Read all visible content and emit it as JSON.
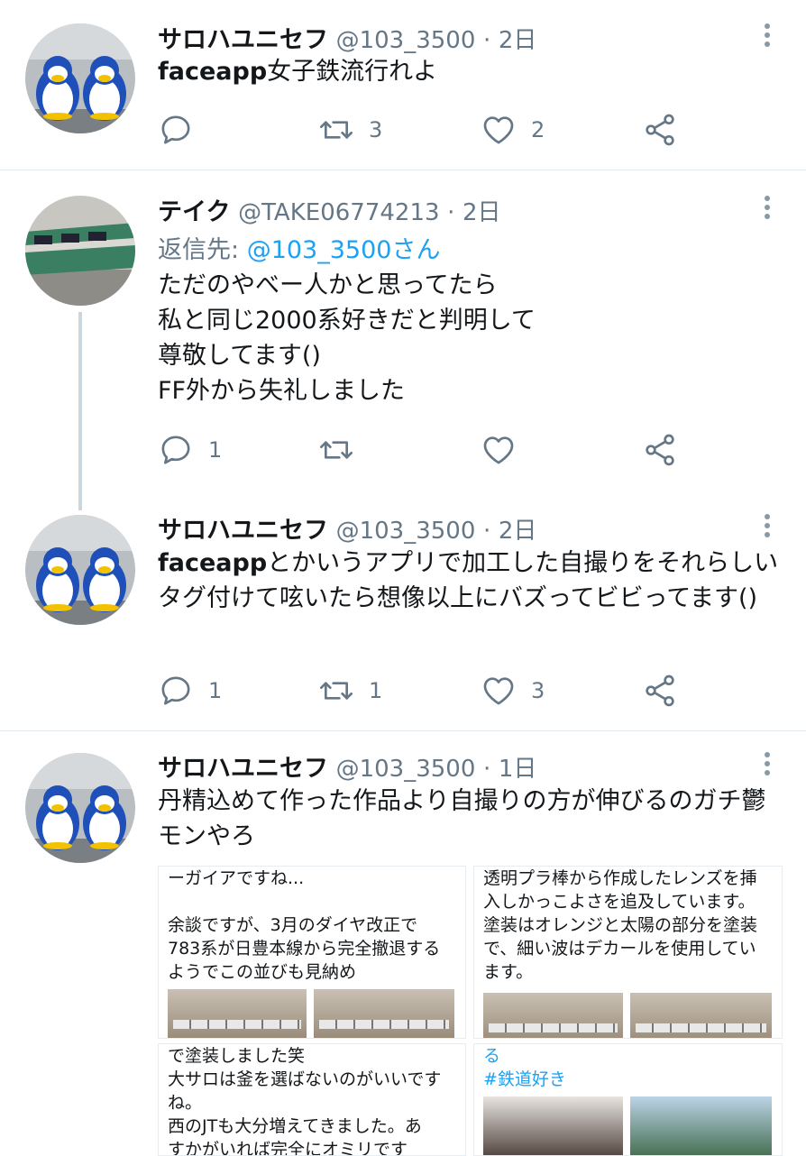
{
  "tweets": [
    {
      "name": "サロハユニセフ",
      "handle": "@103_3500",
      "time": "2日",
      "text_bold": "faceapp",
      "text": "女子鉄流行れよ",
      "retweets": "3",
      "likes": "2",
      "replies": ""
    },
    {
      "name": "テイク",
      "handle": "@TAKE06774213",
      "time": "2日",
      "reply_label": "返信先:",
      "reply_target": "@103_3500さん",
      "lines": [
        "ただのやべー人かと思ってたら",
        "私と同じ2000系好きだと判明して",
        "尊敬してます()",
        "FF外から失礼しました"
      ],
      "replies": "1",
      "retweets": "",
      "likes": ""
    },
    {
      "name": "サロハユニセフ",
      "handle": "@103_3500",
      "time": "2日",
      "text_bold": "faceapp",
      "text": "とかいうアプリで加工した自撮りをそれらしいタグ付けて呟いたら想像以上にバズってビビってます()",
      "replies": "1",
      "retweets": "1",
      "likes": "3"
    },
    {
      "name": "サロハユニセフ",
      "handle": "@103_3500",
      "time": "1日",
      "text": "丹精込めて作った作品より自撮りの方が伸びるのガチ鬱モンやろ"
    }
  ],
  "embedded": {
    "card1": [
      "ーガイアですね...",
      "",
      "余談ですが、3月のダイヤ改正で",
      "783系が日豊本線から完全撤退する",
      "ようでこの並びも見納め"
    ],
    "card2": [
      "透明プラ棒から作成したレンズを挿",
      "入しかっこよさを追及しています。",
      "塗装はオレンジと太陽の部分を塗装",
      "で、細い波はデカールを使用してい",
      "ます。"
    ],
    "card3": [
      "で塗装しました笑",
      "大サロは釜を選ばないのがいいです",
      "ね。",
      "西のJTも大分増えてきました。あ",
      "すかがいれば完全にオミリです"
    ],
    "card4_top": "る",
    "card4_tag": "#鉄道好き"
  },
  "sep": "·",
  "icons": [
    "reply-icon",
    "retweet-icon",
    "like-icon",
    "share-icon",
    "more-icon"
  ],
  "colors": {
    "link": "#1da1f2",
    "muted": "#657786",
    "divider": "#e1e8ed"
  }
}
